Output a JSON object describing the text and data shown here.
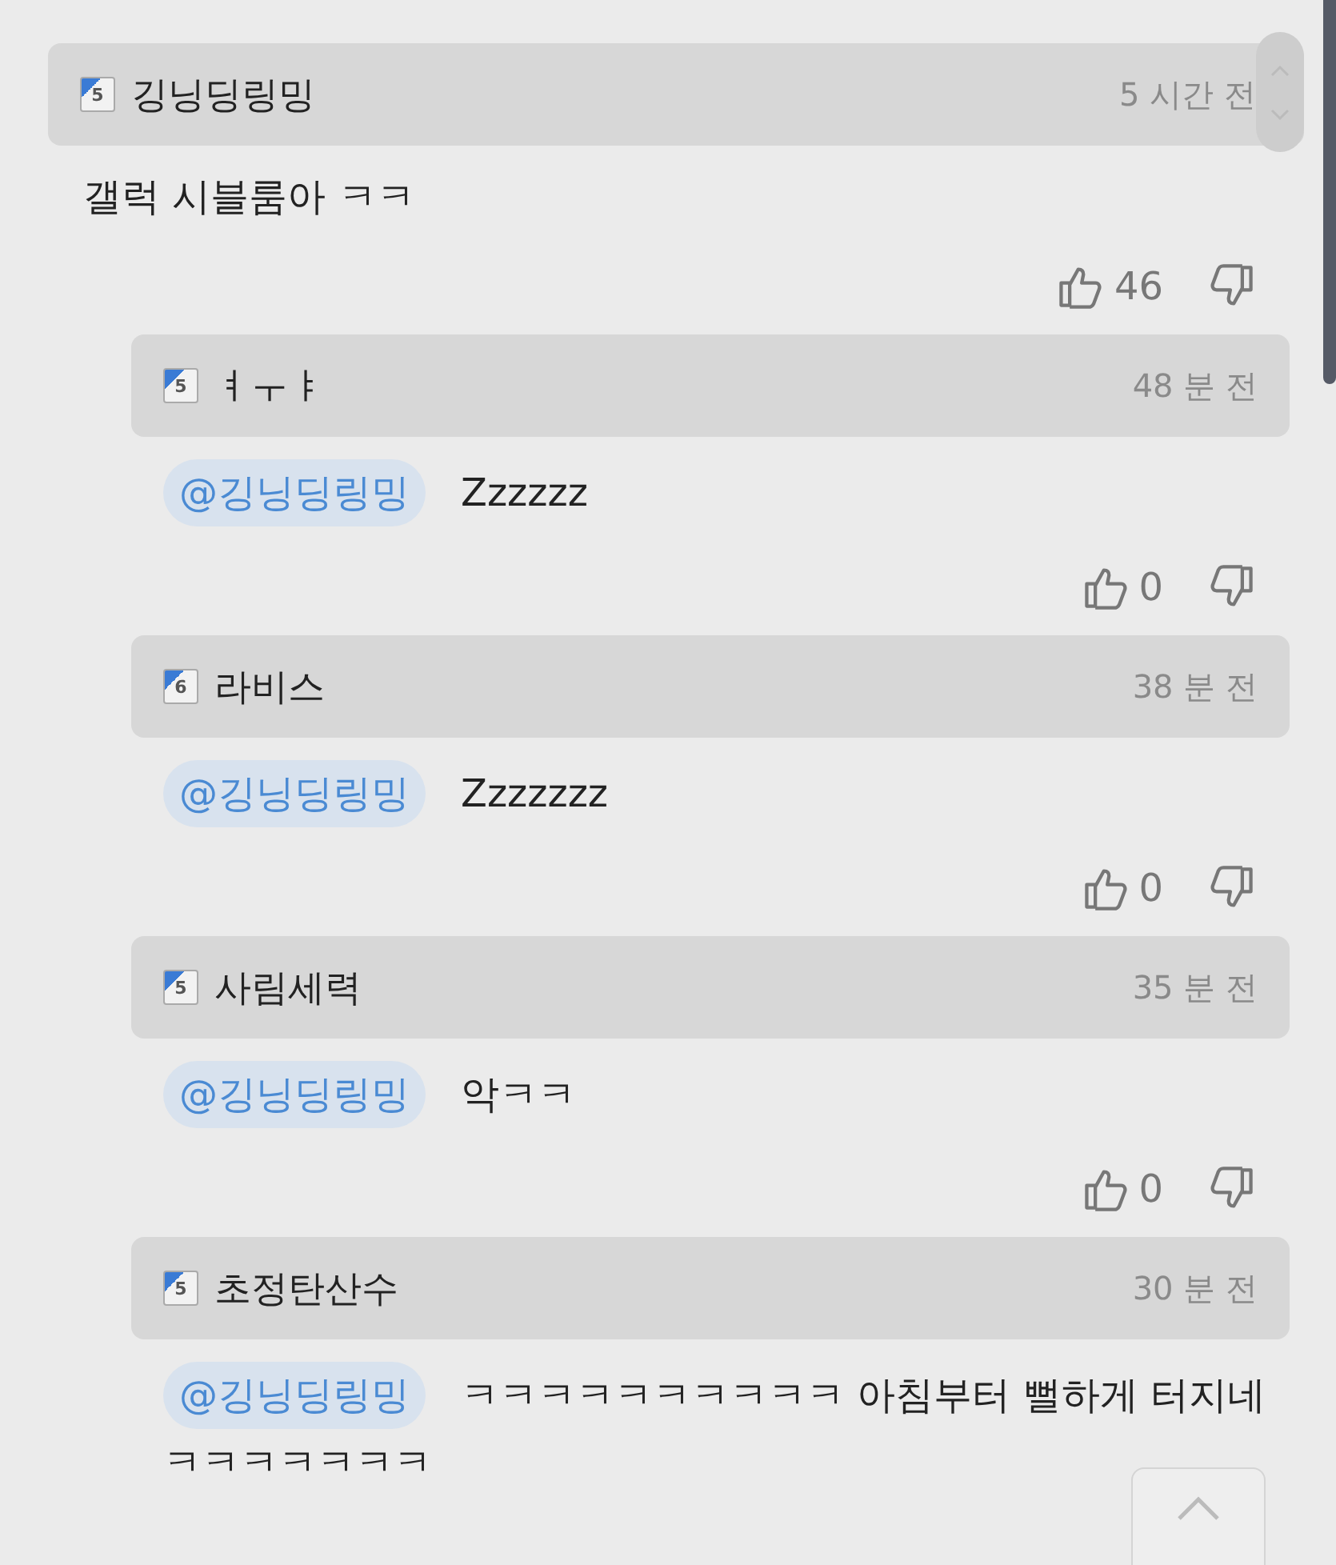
{
  "comment": {
    "author": "깅닝딩링밍",
    "rank": "5",
    "time": "5 시간 전",
    "text": "갤럭 시블룸아 ㅋㅋ",
    "likes": "46"
  },
  "replies": [
    {
      "author": "ㅕㅜㅑ",
      "rank": "5",
      "time": "48 분 전",
      "mention": "@깅닝딩링밍",
      "text": "Zzzzzz",
      "likes": "0"
    },
    {
      "author": "라비스",
      "rank": "6",
      "time": "38 분 전",
      "mention": "@깅닝딩링밍",
      "text": "Zzzzzzz",
      "likes": "0"
    },
    {
      "author": "사림세력",
      "rank": "5",
      "time": "35 분 전",
      "mention": "@깅닝딩링밍",
      "text": "악ㅋㅋ",
      "likes": "0"
    },
    {
      "author": "초정탄산수",
      "rank": "5",
      "time": "30 분 전",
      "mention": "@깅닝딩링밍",
      "text": "ㅋㅋㅋㅋㅋㅋㅋㅋㅋㅋ 아침부터 뻘하게 터지네",
      "text_continued": "ㅋㅋㅋㅋㅋㅋㅋ"
    }
  ]
}
